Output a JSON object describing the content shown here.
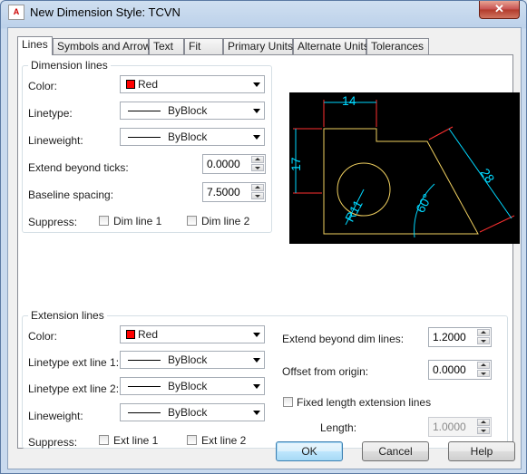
{
  "window": {
    "title": "New Dimension Style: TCVN",
    "app_icon_text": "A",
    "close_glyph": "✕"
  },
  "tabs": [
    "Lines",
    "Symbols and Arrows",
    "Text",
    "Fit",
    "Primary Units",
    "Alternate Units",
    "Tolerances"
  ],
  "active_tab": "Lines",
  "dimension_lines": {
    "legend": "Dimension lines",
    "color_label": "Color:",
    "color_value": "Red",
    "color_swatch": "#ff0000",
    "linetype_label": "Linetype:",
    "linetype_value": "ByBlock",
    "lineweight_label": "Lineweight:",
    "lineweight_value": "ByBlock",
    "extend_label": "Extend beyond ticks:",
    "extend_value": "0.0000",
    "baseline_label": "Baseline spacing:",
    "baseline_value": "7.5000",
    "suppress_label": "Suppress:",
    "dim_line1": "Dim line 1",
    "dim_line2": "Dim line 2"
  },
  "extension_lines": {
    "legend": "Extension lines",
    "color_label": "Color:",
    "color_value": "Red",
    "color_swatch": "#ff0000",
    "linetype1_label": "Linetype ext line 1:",
    "linetype1_value": "ByBlock",
    "linetype2_label": "Linetype ext line 2:",
    "linetype2_value": "ByBlock",
    "lineweight_label": "Lineweight:",
    "lineweight_value": "ByBlock",
    "suppress_label": "Suppress:",
    "ext_line1": "Ext line 1",
    "ext_line2": "Ext line 2",
    "extend_dim_label": "Extend beyond dim lines:",
    "extend_dim_value": "1.2000",
    "offset_label": "Offset from origin:",
    "offset_value": "0.0000",
    "fixed_length_label": "Fixed length extension lines",
    "length_label": "Length:",
    "length_value": "1.0000"
  },
  "preview": {
    "dims": [
      "14",
      "17",
      "28",
      "60°",
      "R11"
    ],
    "dim_color": "#00d8ff",
    "object_color": "#f0d060",
    "ext_color": "#ff3030"
  },
  "buttons": {
    "ok": "OK",
    "cancel": "Cancel",
    "help": "Help"
  }
}
